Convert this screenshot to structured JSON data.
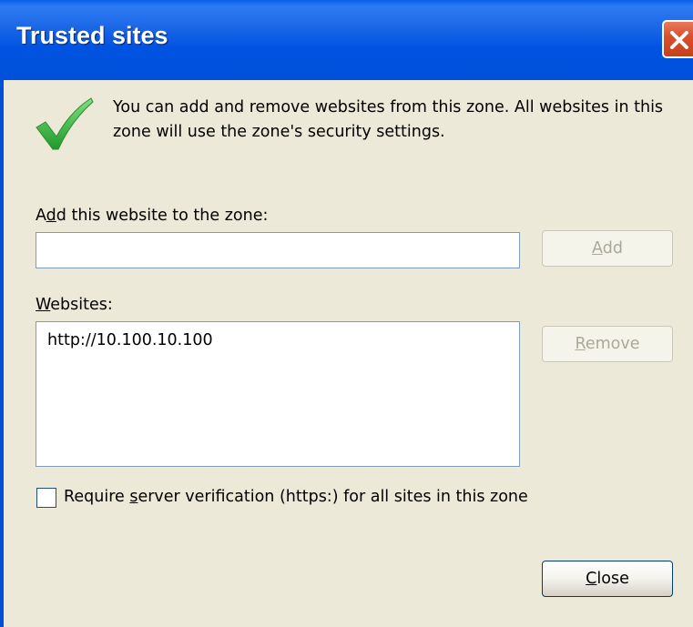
{
  "window": {
    "title": "Trusted sites"
  },
  "intro": {
    "text": "You can add and remove websites from this zone. All websites in this zone will use the zone's security settings."
  },
  "add_site": {
    "label_pre": "A",
    "label_access": "d",
    "label_post": "d this website to the zone:",
    "value": "",
    "add_pre": "",
    "add_access": "A",
    "add_post": "dd"
  },
  "websites": {
    "label_access": "W",
    "label_post": "ebsites:",
    "items": [
      "http://10.100.10.100"
    ],
    "remove_access": "R",
    "remove_post": "emove"
  },
  "verification": {
    "label_pre": "Require ",
    "label_access": "s",
    "label_post": "erver verification (https:) for all sites in this zone",
    "checked": false
  },
  "footer": {
    "close_access": "C",
    "close_post": "lose"
  },
  "icons": {
    "check": "checkmark-icon",
    "close": "close-icon"
  },
  "colors": {
    "titlebar": "#0050DA",
    "close_button": "#D9512C",
    "checkmark": "#3CB43C",
    "dialog_bg": "#ECE9D8"
  }
}
